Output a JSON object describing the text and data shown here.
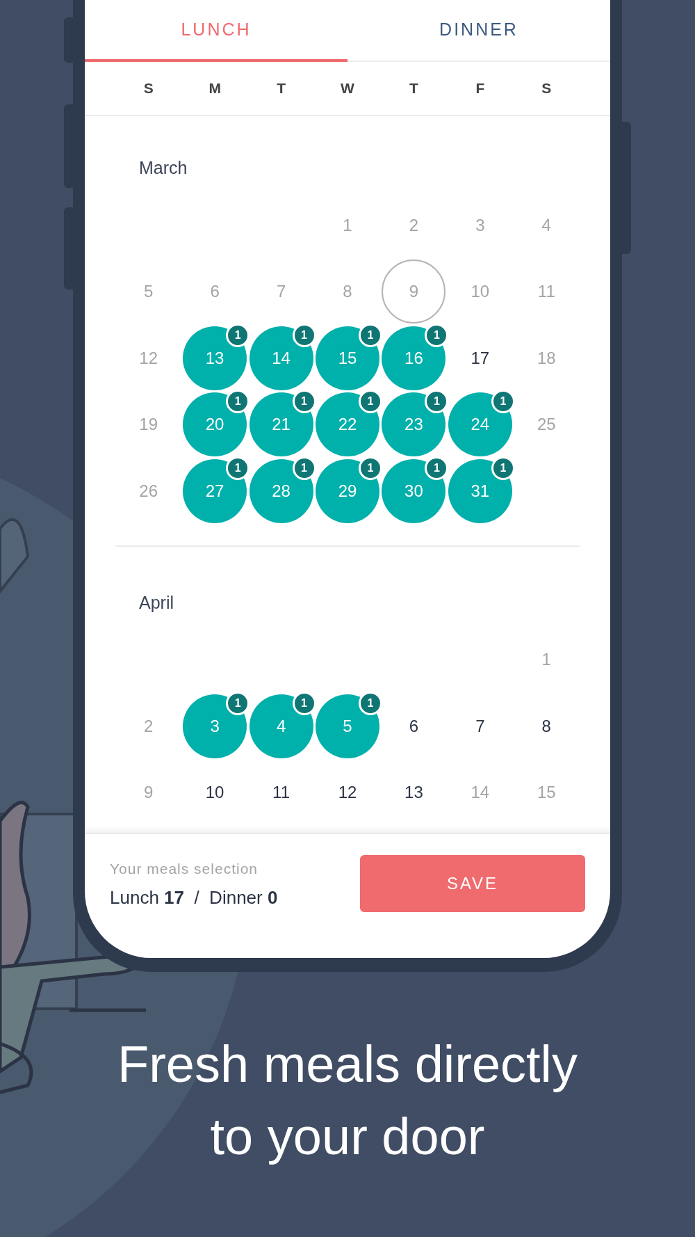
{
  "tabs": [
    {
      "label": "LUNCH",
      "selected": true
    },
    {
      "label": "DINNER",
      "selected": false
    }
  ],
  "weekdays": [
    "S",
    "M",
    "T",
    "W",
    "T",
    "F",
    "S"
  ],
  "months": [
    {
      "name": "March",
      "weeks": [
        {
          "kind": "first",
          "days": [
            {
              "day": "1",
              "kind": "past"
            },
            {
              "day": "2",
              "kind": "past"
            },
            {
              "day": "3",
              "kind": "past"
            },
            {
              "day": "4",
              "kind": "past"
            }
          ]
        },
        {
          "kind": "full",
          "days": [
            {
              "day": "5",
              "kind": "past"
            },
            {
              "day": "6",
              "kind": "past"
            },
            {
              "day": "7",
              "kind": "past"
            },
            {
              "day": "8",
              "kind": "past"
            },
            {
              "day": "9",
              "kind": "today"
            },
            {
              "day": "10",
              "kind": "past"
            },
            {
              "day": "11",
              "kind": "past"
            }
          ]
        },
        {
          "kind": "full",
          "days": [
            {
              "day": "12",
              "kind": "past"
            },
            {
              "day": "13",
              "kind": "selected",
              "badge": "1"
            },
            {
              "day": "14",
              "kind": "selected",
              "badge": "1"
            },
            {
              "day": "15",
              "kind": "selected",
              "badge": "1"
            },
            {
              "day": "16",
              "kind": "selected",
              "badge": "1"
            },
            {
              "day": "17",
              "kind": "open"
            },
            {
              "day": "18",
              "kind": "past"
            }
          ]
        },
        {
          "kind": "full",
          "days": [
            {
              "day": "19",
              "kind": "past"
            },
            {
              "day": "20",
              "kind": "selected",
              "badge": "1"
            },
            {
              "day": "21",
              "kind": "selected",
              "badge": "1"
            },
            {
              "day": "22",
              "kind": "selected",
              "badge": "1"
            },
            {
              "day": "23",
              "kind": "selected",
              "badge": "1"
            },
            {
              "day": "24",
              "kind": "selected",
              "badge": "1"
            },
            {
              "day": "25",
              "kind": "past"
            }
          ]
        },
        {
          "kind": "last",
          "days": [
            {
              "day": "26",
              "kind": "past"
            },
            {
              "day": "27",
              "kind": "selected",
              "badge": "1"
            },
            {
              "day": "28",
              "kind": "selected",
              "badge": "1"
            },
            {
              "day": "29",
              "kind": "selected",
              "badge": "1"
            },
            {
              "day": "30",
              "kind": "selected",
              "badge": "1"
            },
            {
              "day": "31",
              "kind": "selected",
              "badge": "1"
            }
          ]
        }
      ]
    },
    {
      "name": "April",
      "weeks": [
        {
          "kind": "first",
          "days": [
            {
              "day": "1",
              "kind": "past"
            }
          ]
        },
        {
          "kind": "full",
          "days": [
            {
              "day": "2",
              "kind": "past"
            },
            {
              "day": "3",
              "kind": "selected",
              "badge": "1"
            },
            {
              "day": "4",
              "kind": "selected",
              "badge": "1"
            },
            {
              "day": "5",
              "kind": "selected",
              "badge": "1"
            },
            {
              "day": "6",
              "kind": "open"
            },
            {
              "day": "7",
              "kind": "open"
            },
            {
              "day": "8",
              "kind": "open"
            }
          ]
        },
        {
          "kind": "full",
          "days": [
            {
              "day": "9",
              "kind": "past"
            },
            {
              "day": "10",
              "kind": "open"
            },
            {
              "day": "11",
              "kind": "open"
            },
            {
              "day": "12",
              "kind": "open"
            },
            {
              "day": "13",
              "kind": "open"
            },
            {
              "day": "14",
              "kind": "past"
            },
            {
              "day": "15",
              "kind": "past"
            }
          ]
        }
      ]
    }
  ],
  "footer": {
    "label": "Your meals selection",
    "summary": "Lunch **17**  /  Dinner **0**",
    "button": "SAVE"
  },
  "tagline": [
    "Fresh meals directly",
    "to your door"
  ]
}
